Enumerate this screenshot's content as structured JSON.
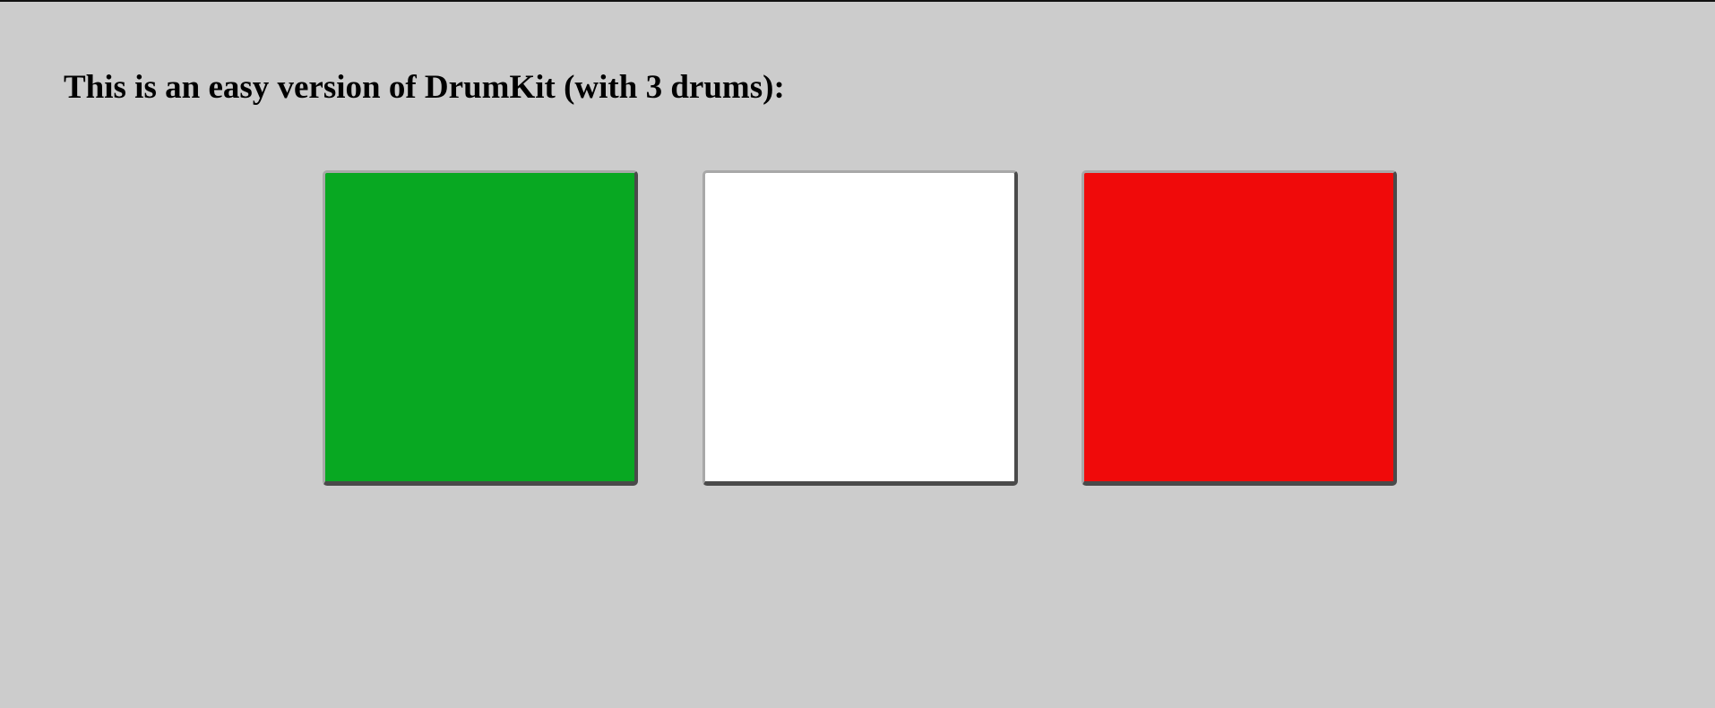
{
  "page": {
    "heading": "This is an easy version of DrumKit (with 3 drums):",
    "background_color": "#cccccc"
  },
  "drums": [
    {
      "name": "drum-green",
      "color": "#08a822"
    },
    {
      "name": "drum-white",
      "color": "#ffffff"
    },
    {
      "name": "drum-red",
      "color": "#f00a0a"
    }
  ]
}
